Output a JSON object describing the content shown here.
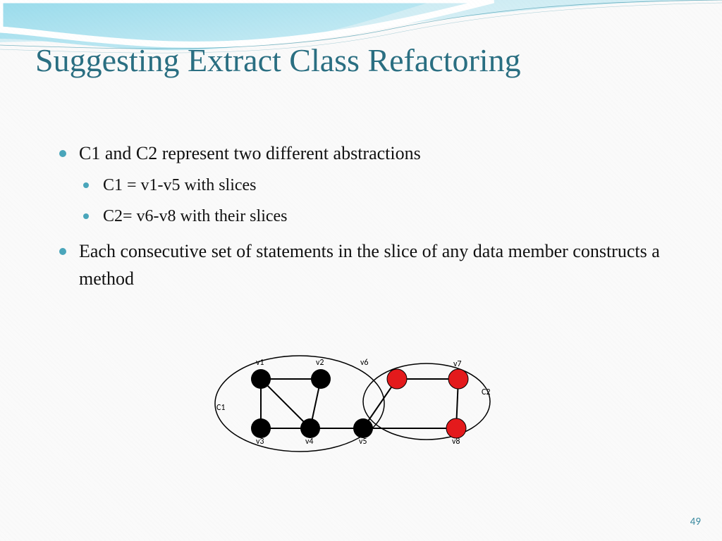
{
  "title": "Suggesting Extract Class Refactoring",
  "bullets": {
    "b1": "C1 and C2 represent two different abstractions",
    "b1a": "C1 = v1-v5 with slices",
    "b1b": "C2= v6-v8 with their slices",
    "b2": "Each consecutive set of statements in the slice of any data member constructs a method"
  },
  "diagram": {
    "c1_label": "C1",
    "c2_label": "C2",
    "v1": "v1",
    "v2": "v2",
    "v3": "v3",
    "v4": "v4",
    "v5": "v5",
    "v6": "v6",
    "v7": "v7",
    "v8": "v8"
  },
  "page_number": "49",
  "chart_data": {
    "type": "diagram",
    "description": "Two overlapping clusters/ellipses C1 and C2 of graph vertices",
    "clusters": [
      {
        "name": "C1",
        "vertices": [
          "v1",
          "v2",
          "v3",
          "v4",
          "v5"
        ],
        "color": "black"
      },
      {
        "name": "C2",
        "vertices": [
          "v6",
          "v7",
          "v8"
        ],
        "color": "red",
        "shared_with_C1": [
          "v5"
        ]
      }
    ],
    "edges": [
      [
        "v1",
        "v2"
      ],
      [
        "v1",
        "v4"
      ],
      [
        "v1",
        "v3"
      ],
      [
        "v2",
        "v4"
      ],
      [
        "v3",
        "v4"
      ],
      [
        "v4",
        "v5"
      ],
      [
        "v5",
        "v6"
      ],
      [
        "v6",
        "v7"
      ],
      [
        "v7",
        "v8"
      ],
      [
        "v5",
        "v8"
      ]
    ]
  }
}
